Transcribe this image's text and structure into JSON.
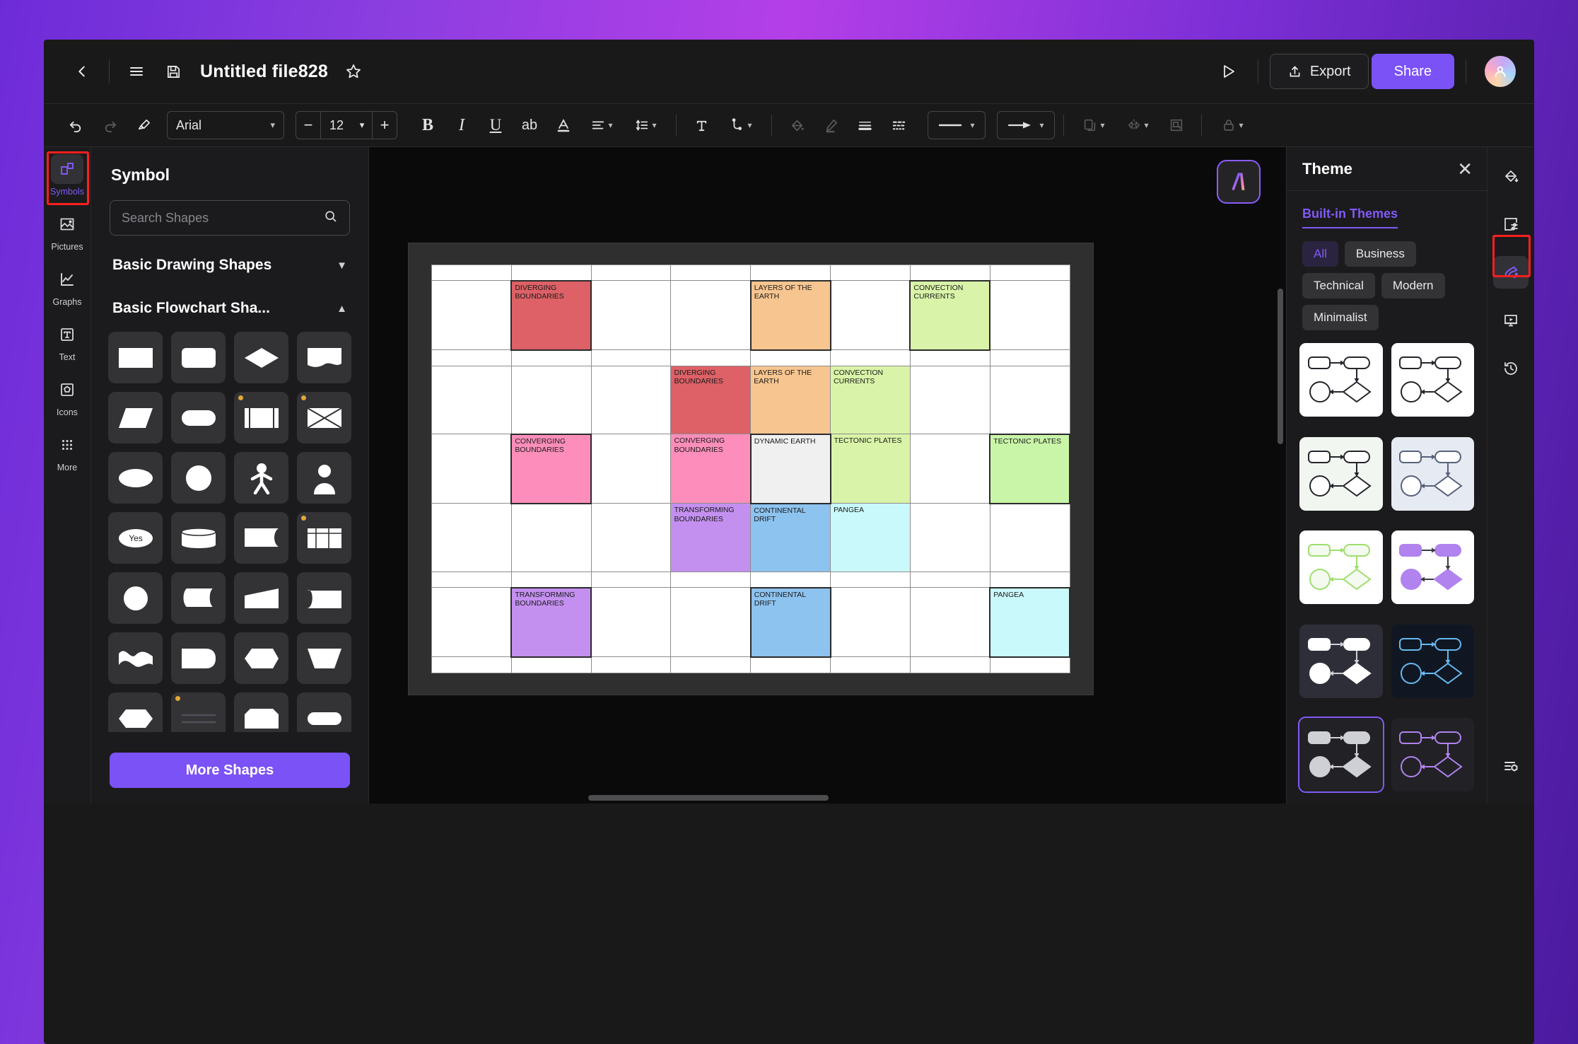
{
  "header": {
    "title": "Untitled file828",
    "back_icon": "chevron-left-icon",
    "menu_icon": "hamburger-menu-icon",
    "save_icon": "floppy-save-icon",
    "star_icon": "star-favorite-icon",
    "present_icon": "play-present-icon",
    "export_label": "Export",
    "share_label": "Share",
    "avatar_icon": "user-avatar-icon"
  },
  "toolbar": {
    "undo_icon": "undo-icon",
    "redo_icon": "redo-icon",
    "format_painter_icon": "format-painter-icon",
    "font_family": "Arial",
    "font_size": "12",
    "decrease_label": "−",
    "increase_label": "+",
    "bold_label": "B",
    "italic_label": "I",
    "underline_label": "U",
    "strikethrough_label": "ab",
    "font_color_label": "A",
    "align_icon": "text-align-icon",
    "line_spacing_icon": "line-spacing-icon",
    "text_box_icon": "text-box-icon",
    "connector_icon": "connector-icon",
    "fill_icon": "fill-bucket-icon",
    "pen_icon": "pen-icon",
    "line_weight_icon": "line-weight-icon",
    "line_style_icon": "line-style-icon",
    "line_type_icon": "line-type-dropdown-icon",
    "arrow_type_icon": "arrow-type-dropdown-icon",
    "duplicate_icon": "duplicate-layer-icon",
    "mirror_icon": "mirror-flip-icon",
    "crop_icon": "crop-frame-icon",
    "lock_icon": "lock-icon"
  },
  "left_rail": {
    "items": [
      {
        "label": "Symbols",
        "icon": "symbols-icon",
        "active": true
      },
      {
        "label": "Pictures",
        "icon": "pictures-icon",
        "active": false
      },
      {
        "label": "Graphs",
        "icon": "graphs-icon",
        "active": false
      },
      {
        "label": "Text",
        "icon": "text-icon",
        "active": false
      },
      {
        "label": "Icons",
        "icon": "icons-icon",
        "active": false
      },
      {
        "label": "More",
        "icon": "more-grid-icon",
        "active": false
      }
    ]
  },
  "symbol_panel": {
    "title": "Symbol",
    "search_placeholder": "Search Shapes",
    "search_value": "",
    "search_icon": "search-icon",
    "sections": [
      {
        "label": "Basic Drawing Shapes",
        "expanded": false,
        "chevron": "chevron-down-icon"
      },
      {
        "label": "Basic Flowchart Sha...",
        "expanded": true,
        "chevron": "chevron-up-icon"
      }
    ],
    "shapes": [
      {
        "name": "rectangle",
        "badge": false
      },
      {
        "name": "rounded-rectangle",
        "badge": false
      },
      {
        "name": "diamond",
        "badge": false
      },
      {
        "name": "document",
        "badge": false
      },
      {
        "name": "parallelogram",
        "badge": false
      },
      {
        "name": "stadium",
        "badge": false
      },
      {
        "name": "predefined-process",
        "badge": true
      },
      {
        "name": "internal-storage",
        "badge": true
      },
      {
        "name": "ellipse",
        "badge": false
      },
      {
        "name": "circle",
        "badge": false
      },
      {
        "name": "actor-person",
        "badge": false
      },
      {
        "name": "user-bust",
        "badge": false
      },
      {
        "name": "decision-yes",
        "badge": false
      },
      {
        "name": "cylinder-database",
        "badge": false
      },
      {
        "name": "tape-data",
        "badge": false
      },
      {
        "name": "table-grid",
        "badge": true
      },
      {
        "name": "circle-connector",
        "badge": false
      },
      {
        "name": "direct-access-storage",
        "badge": false
      },
      {
        "name": "trapezoid-wedge",
        "badge": false
      },
      {
        "name": "cone-shape",
        "badge": false
      },
      {
        "name": "wave-flag",
        "badge": false
      },
      {
        "name": "delay",
        "badge": false
      },
      {
        "name": "hexagon-preparation",
        "badge": false
      },
      {
        "name": "inverted-trapezoid",
        "badge": false
      },
      {
        "name": "hexagon",
        "badge": false
      },
      {
        "name": "lined-note",
        "badge": true
      },
      {
        "name": "cut-corner-rect",
        "badge": false
      },
      {
        "name": "pill-terminator",
        "badge": false
      }
    ],
    "more_shapes_label": "More Shapes"
  },
  "canvas": {
    "ai_button_icon": "ai-assistant-icon",
    "table": {
      "columns": 8,
      "rows": 9,
      "cells": [
        {
          "row": 1,
          "col": 1,
          "text": "DIVERGING BOUNDARIES",
          "fill": "#dd6166",
          "selected": true
        },
        {
          "row": 1,
          "col": 4,
          "text": "LAYERS OF THE EARTH",
          "fill": "#f7c590",
          "selected": true
        },
        {
          "row": 1,
          "col": 6,
          "text": "CONVECTION CURRENTS",
          "fill": "#d9f4a8",
          "selected": true
        },
        {
          "row": 3,
          "col": 3,
          "text": "DIVERGING BOUNDARIES",
          "fill": "#dd6166",
          "selected": false
        },
        {
          "row": 3,
          "col": 4,
          "text": "LAYERS OF THE EARTH",
          "fill": "#f7c590",
          "selected": false
        },
        {
          "row": 3,
          "col": 5,
          "text": "CONVECTION CURRENTS",
          "fill": "#d9f4a8",
          "selected": false
        },
        {
          "row": 4,
          "col": 1,
          "text": "CONVERGING BOUNDARIES",
          "fill": "#fd8ebb",
          "selected": true
        },
        {
          "row": 4,
          "col": 3,
          "text": "CONVERGING BOUNDARIES",
          "fill": "#fd8ebb",
          "selected": false
        },
        {
          "row": 4,
          "col": 4,
          "text": "DYNAMIC EARTH",
          "fill": "#f0f0f0",
          "selected": true
        },
        {
          "row": 4,
          "col": 5,
          "text": "TECTONIC PLATES",
          "fill": "#d9f4a8",
          "selected": false
        },
        {
          "row": 4,
          "col": 7,
          "text": "TECTONIC PLATES",
          "fill": "#c9f5a8",
          "selected": true
        },
        {
          "row": 5,
          "col": 3,
          "text": "TRANSFORMING BOUNDARIES",
          "fill": "#c490f0",
          "selected": false
        },
        {
          "row": 5,
          "col": 4,
          "text": "CONTINENTAL DRIFT",
          "fill": "#8dc3ef",
          "selected": false
        },
        {
          "row": 5,
          "col": 5,
          "text": "PANGEA",
          "fill": "#caf9fb",
          "selected": false
        },
        {
          "row": 7,
          "col": 1,
          "text": "TRANSFORMING BOUNDARIES",
          "fill": "#c490f0",
          "selected": true
        },
        {
          "row": 7,
          "col": 4,
          "text": "CONTINENTAL DRIFT",
          "fill": "#8dc3ef",
          "selected": true
        },
        {
          "row": 7,
          "col": 7,
          "text": "PANGEA",
          "fill": "#caf9fb",
          "selected": true
        }
      ]
    }
  },
  "theme_panel": {
    "title": "Theme",
    "close_icon": "close-icon",
    "tab_label": "Built-in Themes",
    "filters": [
      {
        "label": "All",
        "active": true
      },
      {
        "label": "Business",
        "active": false
      },
      {
        "label": "Technical",
        "active": false
      },
      {
        "label": "Modern",
        "active": false
      },
      {
        "label": "Minimalist",
        "active": false
      }
    ],
    "thumbnails": [
      {
        "name": "theme-classic-black",
        "bg": "#ffffff",
        "stroke": "#24262b",
        "fill": "#ffffff",
        "arrow": "#24262b",
        "selected": false
      },
      {
        "name": "theme-arrow-black",
        "bg": "#ffffff",
        "stroke": "#24262b",
        "fill": "#ffffff",
        "arrow": "#24262b",
        "selected": false
      },
      {
        "name": "theme-soft-green-bg",
        "bg": "#f2f6f1",
        "stroke": "#24262b",
        "fill": "#ffffff",
        "arrow": "#24262b",
        "selected": false
      },
      {
        "name": "theme-soft-blue-bg",
        "bg": "#e6eaf2",
        "stroke": "#57617a",
        "fill": "#ffffff",
        "arrow": "#57617a",
        "selected": false
      },
      {
        "name": "theme-lime-outline",
        "bg": "#ffffff",
        "stroke": "#9ede6e",
        "fill": "#f4faf0",
        "arrow": "#9ede6e",
        "selected": false
      },
      {
        "name": "theme-purple-solid",
        "bg": "#ffffff",
        "stroke": "#b083ee",
        "fill": "#b083ee",
        "arrow": "#3a3a42",
        "selected": false
      },
      {
        "name": "theme-dark-grey",
        "bg": "#2e2e38",
        "stroke": "#ffffff",
        "fill": "#ffffff",
        "arrow": "#cfcfd6",
        "selected": false
      },
      {
        "name": "theme-dark-navy-blue",
        "bg": "#101722",
        "stroke": "#67b9f0",
        "fill": "#101722",
        "arrow": "#67b9f0",
        "selected": false
      },
      {
        "name": "theme-dark-selected",
        "bg": "#212126",
        "stroke": "#cfcfd6",
        "fill": "#cfcfd6",
        "arrow": "#cfcfd6",
        "selected": true
      },
      {
        "name": "theme-dark-purple",
        "bg": "#212126",
        "stroke": "#b083ee",
        "fill": "#212126",
        "arrow": "#b083ee",
        "selected": false
      }
    ]
  },
  "right_rail": {
    "items": [
      {
        "name": "fill-color-icon",
        "active": false
      },
      {
        "name": "page-setup-icon",
        "active": false
      },
      {
        "name": "theme-paint-icon",
        "active": true
      },
      {
        "name": "presentation-icon",
        "active": false
      },
      {
        "name": "history-icon",
        "active": false
      }
    ],
    "bottom": {
      "name": "properties-panel-icon",
      "active": false
    }
  }
}
